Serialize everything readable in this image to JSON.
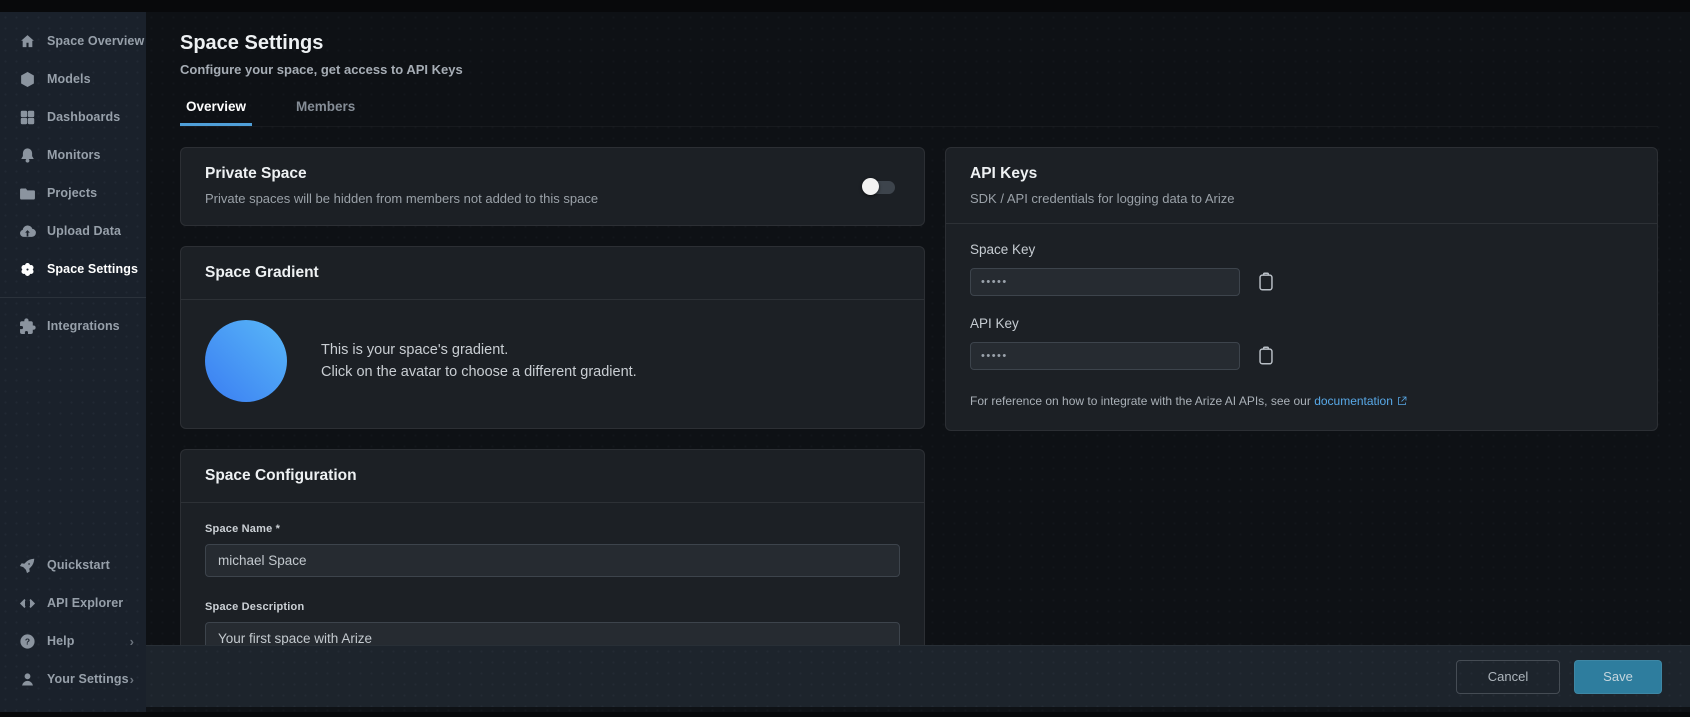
{
  "colors": {
    "accent-blue": "#4f9fd8",
    "link-blue": "#58a9e8",
    "save-teal": "#2e7d9e",
    "avatar-blue-light": "#59b8f8",
    "avatar-blue-dark": "#3a7df2"
  },
  "sidebar": {
    "items": [
      {
        "label": "Space Overview",
        "icon": "home-icon",
        "active": false
      },
      {
        "label": "Models",
        "icon": "cube-icon",
        "active": false
      },
      {
        "label": "Dashboards",
        "icon": "grid-icon",
        "active": false
      },
      {
        "label": "Monitors",
        "icon": "bell-icon",
        "active": false
      },
      {
        "label": "Projects",
        "icon": "folder-icon",
        "active": false
      },
      {
        "label": "Upload Data",
        "icon": "cloud-upload-icon",
        "active": false
      },
      {
        "label": "Space Settings",
        "icon": "gear-flower-icon",
        "active": true
      },
      {
        "label": "Integrations",
        "icon": "puzzle-icon",
        "active": false
      }
    ],
    "footer_items": [
      {
        "label": "Quickstart",
        "icon": "rocket-icon",
        "chevron": false
      },
      {
        "label": "API Explorer",
        "icon": "code-brackets-icon",
        "chevron": false
      },
      {
        "label": "Help",
        "icon": "question-circle-icon",
        "chevron": true
      },
      {
        "label": "Your Settings",
        "icon": "person-icon",
        "chevron": true
      }
    ],
    "chevron_glyph": "›"
  },
  "header": {
    "title": "Space Settings",
    "subtitle": "Configure your space, get access to API Keys",
    "tabs": [
      {
        "label": "Overview",
        "active": true
      },
      {
        "label": "Members",
        "active": false
      }
    ]
  },
  "private_space": {
    "title": "Private Space",
    "description": "Private spaces will be hidden from members not added to this space",
    "toggle_on": false
  },
  "space_gradient": {
    "title": "Space Gradient",
    "line1": "This is your space's gradient.",
    "line2": "Click on the avatar to choose a different gradient."
  },
  "space_configuration": {
    "title": "Space Configuration",
    "name_label": "Space Name *",
    "name_value": "michael Space",
    "description_label": "Space Description",
    "description_value": "Your first space with Arize"
  },
  "api_keys": {
    "title": "API Keys",
    "subtitle": "SDK / API credentials for logging data to Arize",
    "space_key_label": "Space Key",
    "space_key_value": "•••••",
    "api_key_label": "API Key",
    "api_key_value": "•••••",
    "footnote_prefix": "For reference on how to integrate with the Arize AI APIs, see our ",
    "footnote_link": "documentation"
  },
  "footer": {
    "cancel_label": "Cancel",
    "save_label": "Save"
  }
}
